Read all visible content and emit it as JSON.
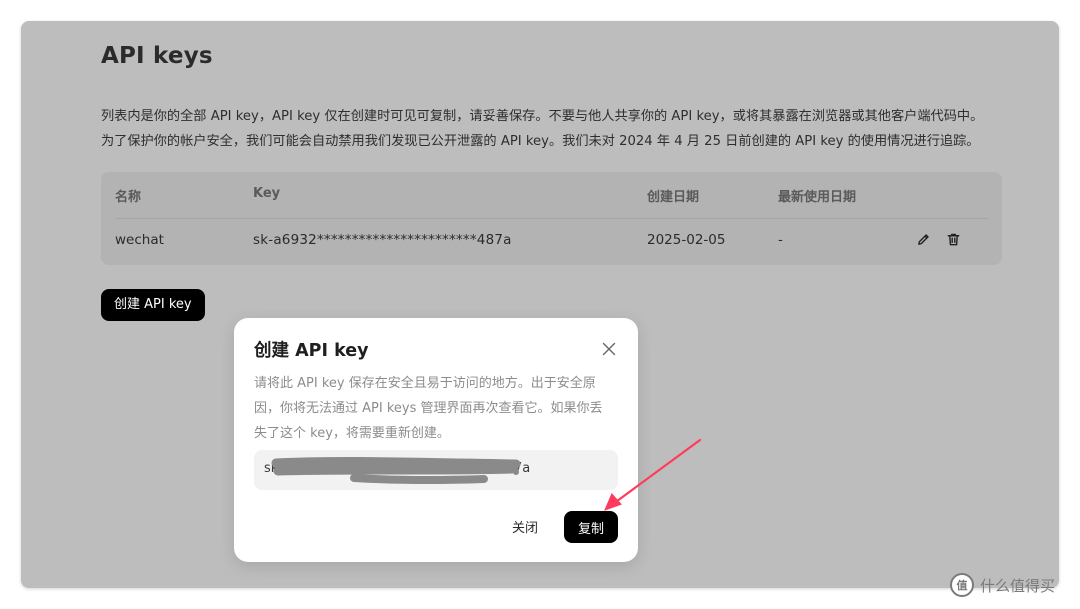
{
  "page": {
    "title": "API keys",
    "description": [
      "列表内是你的全部 API key，API key 仅在创建时可见可复制，请妥善保存。不要与他人共享你的 API key，或将其暴露在浏览器或其他客户端代码中。",
      "为了保护你的帐户安全，我们可能会自动禁用我们发现已公开泄露的 API key。我们未对 2024 年 4 月 25 日前创建的 API key 的使用情况进行追踪。"
    ]
  },
  "table": {
    "headers": [
      "名称",
      "Key",
      "创建日期",
      "最新使用日期"
    ],
    "rows": [
      {
        "name": "wechat",
        "key": "sk-a6932***********************487a",
        "created": "2025-02-05",
        "last_used": "-"
      }
    ],
    "edit_icon": "pencil-icon",
    "delete_icon": "trash-icon"
  },
  "create_button": {
    "label": "创建 API key"
  },
  "modal": {
    "title": "创建 API key",
    "close_icon": "close-icon",
    "description": [
      "请将此 API key 保存在安全且易于访问的地方。出于安全原",
      "因，你将无法通过 API keys 管理界面再次查看它。如果你丢",
      "失了这个 key，将需要重新创建。"
    ],
    "key_prefix": "sk",
    "key_suffix": "7a",
    "close_label": "关闭",
    "copy_label": "复制"
  },
  "annotation": {
    "arrow_color": "#ff3b5c"
  },
  "watermark": {
    "text": "什么值得买",
    "logo": "值"
  }
}
